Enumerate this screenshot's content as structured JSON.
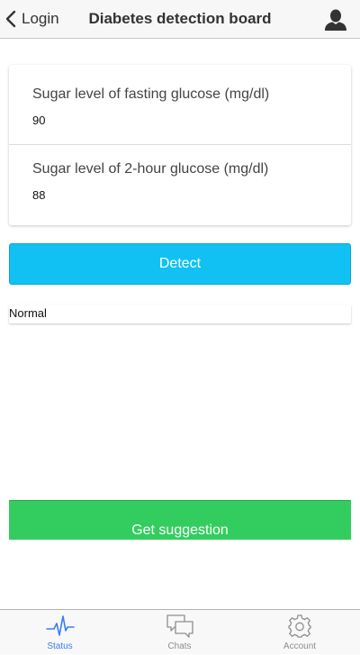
{
  "header": {
    "back_label": "Login",
    "title": "Diabetes detection board"
  },
  "form": {
    "fasting": {
      "label": "Sugar level of fasting glucose (mg/dl)",
      "value": "90"
    },
    "two_hour": {
      "label": "Sugar level of 2-hour glucose (mg/dl)",
      "value": "88"
    }
  },
  "actions": {
    "detect_label": "Detect",
    "suggestion_label": "Get suggestion"
  },
  "result": {
    "text": "Normal"
  },
  "tabs": [
    {
      "label": "Status",
      "icon": "pulse-icon",
      "active": true
    },
    {
      "label": "Chats",
      "icon": "chat-bubbles-icon",
      "active": false
    },
    {
      "label": "Account",
      "icon": "gear-icon",
      "active": false
    }
  ],
  "colors": {
    "detect_button": "#11c1f3",
    "suggestion_button": "#33cd5f",
    "active_tab": "#387ef5",
    "inactive_tab": "#8e8e8e"
  }
}
